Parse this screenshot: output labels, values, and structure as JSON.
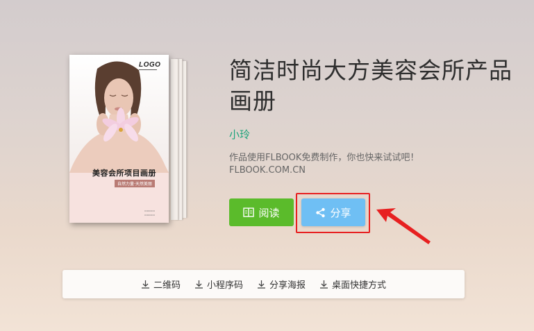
{
  "book": {
    "title": "简洁时尚大方美容会所产品画册",
    "author": "小玲",
    "description": "作品使用FLBOOK免费制作，你也快来试试吧！",
    "site": "FLBOOK.COM.CN"
  },
  "cover": {
    "logo": "LOGO",
    "title": "美容会所项目画册",
    "tagline": "自然力量·天然美丽"
  },
  "actions": {
    "read_label": "阅读",
    "share_label": "分享"
  },
  "toolbar": [
    {
      "label": "二维码",
      "icon": "download-icon"
    },
    {
      "label": "小程序码",
      "icon": "download-icon"
    },
    {
      "label": "分享海报",
      "icon": "download-icon"
    },
    {
      "label": "桌面快捷方式",
      "icon": "download-icon"
    }
  ],
  "colors": {
    "read_button": "#5bbb2b",
    "share_button": "#6fbff4",
    "author": "#1aa37a",
    "annotation": "#e72020"
  }
}
